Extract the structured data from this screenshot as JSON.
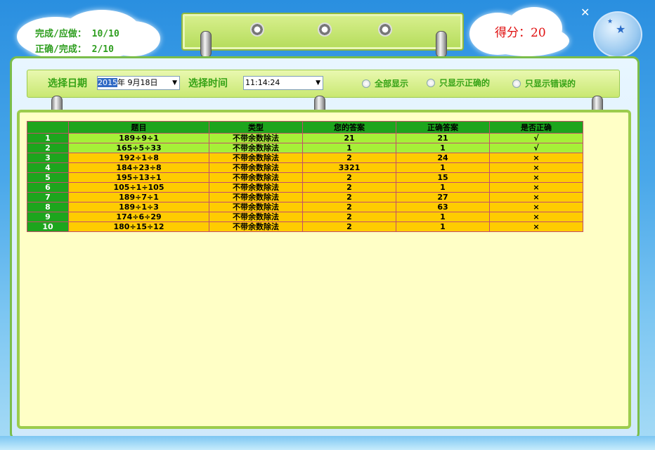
{
  "header": {
    "completed_label": "完成/应做：",
    "completed_value": "10/10",
    "correct_label": "正确/完成：",
    "correct_value": "2/10",
    "score_label": "得分：",
    "score_value": "20",
    "close_symbol": "✕"
  },
  "filter": {
    "date_label": "选择日期",
    "date_year_selected": "2015",
    "date_rest": "年  9月18日",
    "time_label": "选择时间",
    "time_value": "11:14:24",
    "radio_all": "全部显示",
    "radio_correct": "只显示正确的",
    "radio_wrong": "只显示错误的"
  },
  "table": {
    "headers": [
      "",
      "题目",
      "类型",
      "您的答案",
      "正确答案",
      "是否正确"
    ],
    "rows": [
      {
        "n": "1",
        "q": "189÷9÷1",
        "t": "不带余数除法",
        "a": "21",
        "c": "21",
        "r": "√",
        "ok": true
      },
      {
        "n": "2",
        "q": "165÷5÷33",
        "t": "不带余数除法",
        "a": "1",
        "c": "1",
        "r": "√",
        "ok": true
      },
      {
        "n": "3",
        "q": "192÷1÷8",
        "t": "不带余数除法",
        "a": "2",
        "c": "24",
        "r": "×",
        "ok": false
      },
      {
        "n": "4",
        "q": "184÷23÷8",
        "t": "不带余数除法",
        "a": "3321",
        "c": "1",
        "r": "×",
        "ok": false
      },
      {
        "n": "5",
        "q": "195÷13÷1",
        "t": "不带余数除法",
        "a": "2",
        "c": "15",
        "r": "×",
        "ok": false
      },
      {
        "n": "6",
        "q": "105÷1÷105",
        "t": "不带余数除法",
        "a": "2",
        "c": "1",
        "r": "×",
        "ok": false
      },
      {
        "n": "7",
        "q": "189÷7÷1",
        "t": "不带余数除法",
        "a": "2",
        "c": "27",
        "r": "×",
        "ok": false
      },
      {
        "n": "8",
        "q": "189÷1÷3",
        "t": "不带余数除法",
        "a": "2",
        "c": "63",
        "r": "×",
        "ok": false
      },
      {
        "n": "9",
        "q": "174÷6÷29",
        "t": "不带余数除法",
        "a": "2",
        "c": "1",
        "r": "×",
        "ok": false
      },
      {
        "n": "10",
        "q": "180÷15÷12",
        "t": "不带余数除法",
        "a": "2",
        "c": "1",
        "r": "×",
        "ok": false
      }
    ]
  }
}
